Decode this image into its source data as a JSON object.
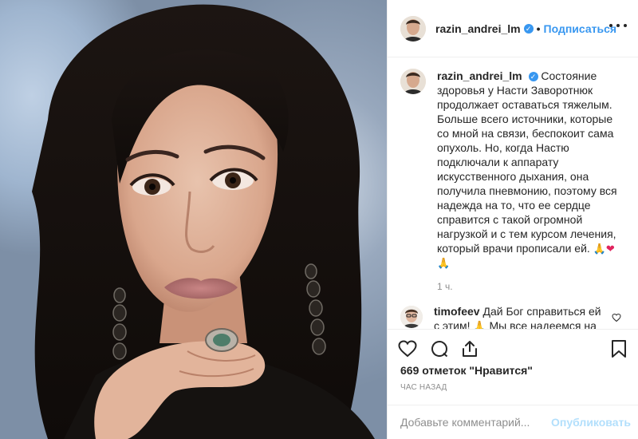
{
  "post": {
    "author": {
      "username": "razin_andrei_lm",
      "verified_icon": "verified-badge-icon",
      "follow_label": "Подписаться",
      "separator": "•"
    },
    "caption": {
      "text": "Состояние здоровья у Насти Заворотнюк продолжает оставаться тяжелым. Больше всего источники, которые со мной на связи, беспокоит сама опухоль. Но, когда Настю подключали к аппарату искусственного дыхания, она получила пневмонию, поэтому вся надежда на то, что ее сердце справится с такой огромной нагрузкой и с тем курсом лечения, который врачи прописали ей.",
      "emojis": [
        "🙏",
        "❤",
        "🙏"
      ],
      "time_ago": "1 ч."
    },
    "comments": [
      {
        "username": "timofeev",
        "text": "Дай Бог справиться ей с этим!",
        "text_after": "Мы все надеемся на чудо!",
        "emojis": [
          "🙏",
          "❤"
        ]
      }
    ],
    "actions": {
      "like_icon": "heart-icon",
      "comment_icon": "comment-icon",
      "share_icon": "share-icon",
      "save_icon": "bookmark-icon"
    },
    "likes_text": "669 отметок \"Нравится\"",
    "posted_text": "час назад",
    "add_comment": {
      "placeholder": "Добавьте комментарий...",
      "publish_label": "Опубликовать"
    },
    "colors": {
      "accent": "#3897f0",
      "publish_disabled": "#b2dffc",
      "muted": "#8e8e8e",
      "text": "#262626",
      "border": "#efefef",
      "heart": "#e0245e"
    }
  }
}
